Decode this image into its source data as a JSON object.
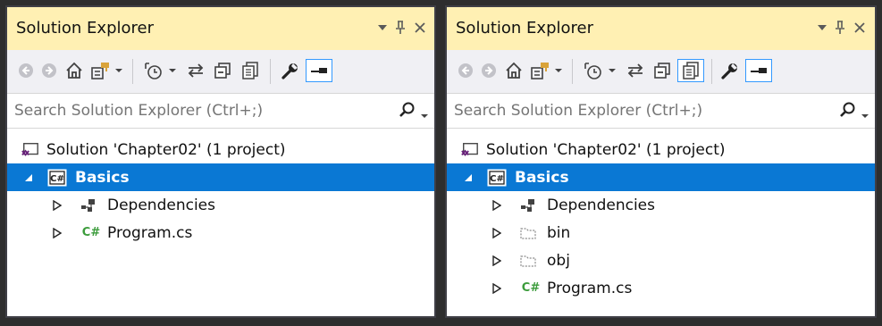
{
  "left_panel": {
    "title": "Solution Explorer",
    "search_placeholder": "Search Solution Explorer (Ctrl+;)",
    "tree": [
      {
        "label": "Solution 'Chapter02' (1 project)",
        "icon": "visual-studio-solution-icon"
      },
      {
        "label": "Basics",
        "icon": "csharp-project-icon",
        "selected": true,
        "expanded": true
      },
      {
        "label": "Dependencies",
        "icon": "dependencies-icon"
      },
      {
        "label": "Program.cs",
        "icon": "csharp-file-icon"
      }
    ]
  },
  "right_panel": {
    "title": "Solution Explorer",
    "search_placeholder": "Search Solution Explorer (Ctrl+;)",
    "show_all_files_active": true,
    "tree": [
      {
        "label": "Solution 'Chapter02' (1 project)",
        "icon": "visual-studio-solution-icon"
      },
      {
        "label": "Basics",
        "icon": "csharp-project-icon",
        "selected": true,
        "expanded": true
      },
      {
        "label": "Dependencies",
        "icon": "dependencies-icon"
      },
      {
        "label": "bin",
        "icon": "hidden-folder-icon"
      },
      {
        "label": "obj",
        "icon": "hidden-folder-icon"
      },
      {
        "label": "Program.cs",
        "icon": "csharp-file-icon"
      }
    ]
  },
  "glyphs": {
    "csharp_badge": "C#",
    "csharp_file": "C#"
  },
  "colors": {
    "title_bg": "#fff0b3",
    "selection": "#0a78d4",
    "csharp_green": "#3c9c3c",
    "vs_purple": "#68217a"
  }
}
